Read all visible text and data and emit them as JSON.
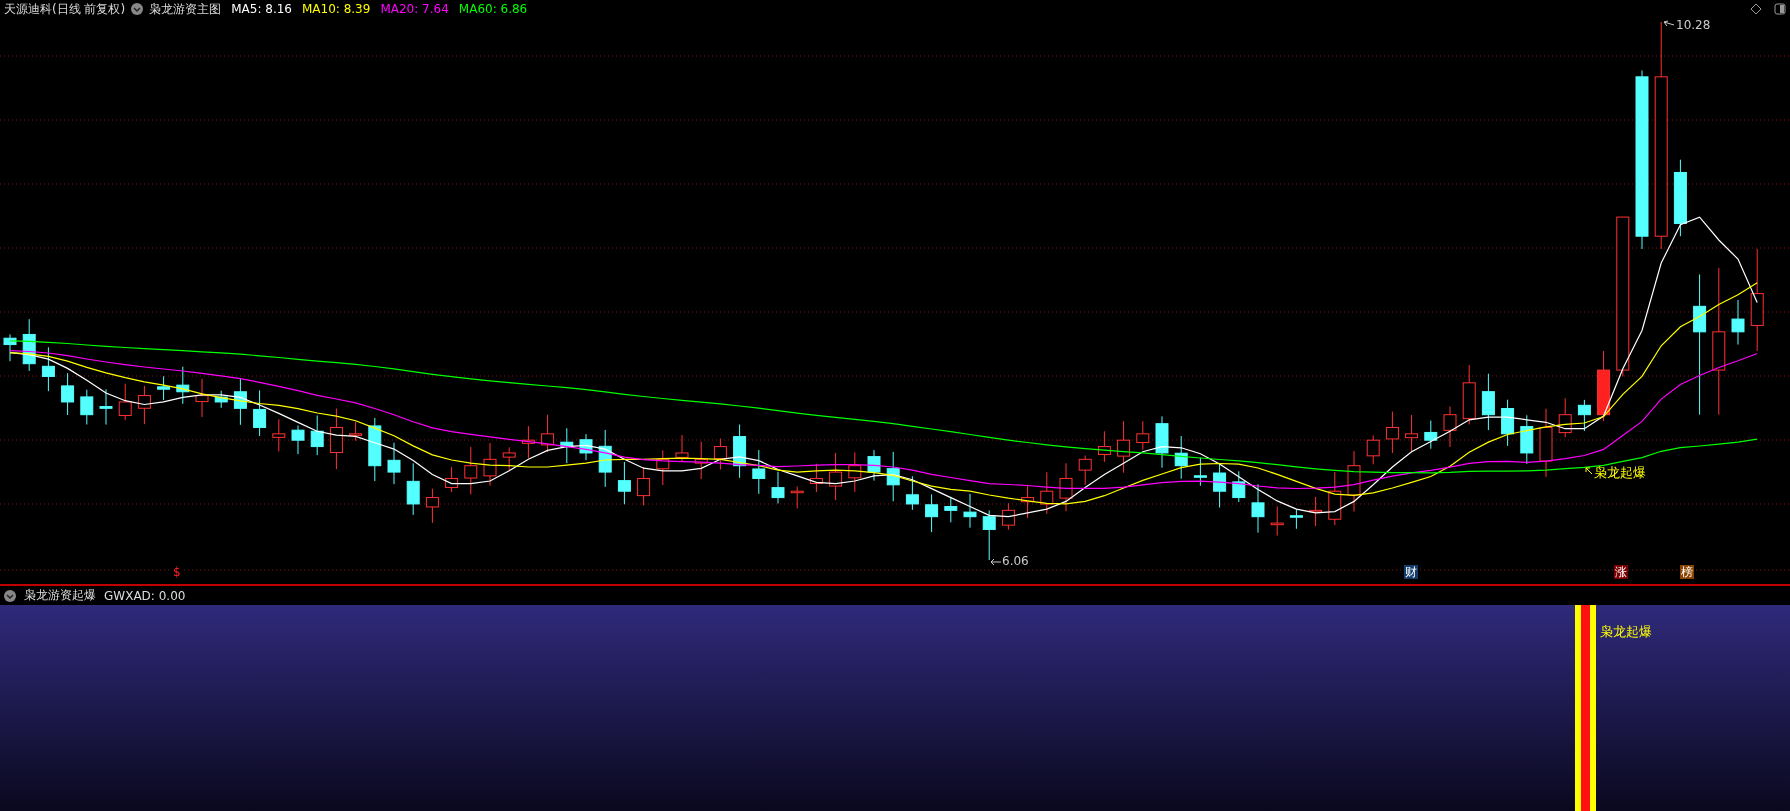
{
  "header": {
    "stock": "天源迪科(日线 前复权)",
    "indicator": "枭龙游资主图",
    "ma": [
      {
        "label": "MA5: 8.16",
        "color": "#ffffff"
      },
      {
        "label": "MA10: 8.39",
        "color": "#ffff00"
      },
      {
        "label": "MA20: 7.64",
        "color": "#ff00ff"
      },
      {
        "label": "MA60: 6.86",
        "color": "#00ff00"
      }
    ]
  },
  "chart": {
    "high_label": "10.28",
    "low_label": "6.06",
    "signal_label": "枭龙起爆",
    "event_tags": [
      {
        "text": "$",
        "color": "#000000"
      },
      {
        "text": "财",
        "color": "#123d6b"
      },
      {
        "text": "涨",
        "color": "#7a0000"
      },
      {
        "text": "榜",
        "color": "#8a4200"
      }
    ]
  },
  "sub_panel": {
    "title": "枭龙游资起爆",
    "reading": "GWXAD: 0.00",
    "signal_label": "枭龙起爆"
  }
}
